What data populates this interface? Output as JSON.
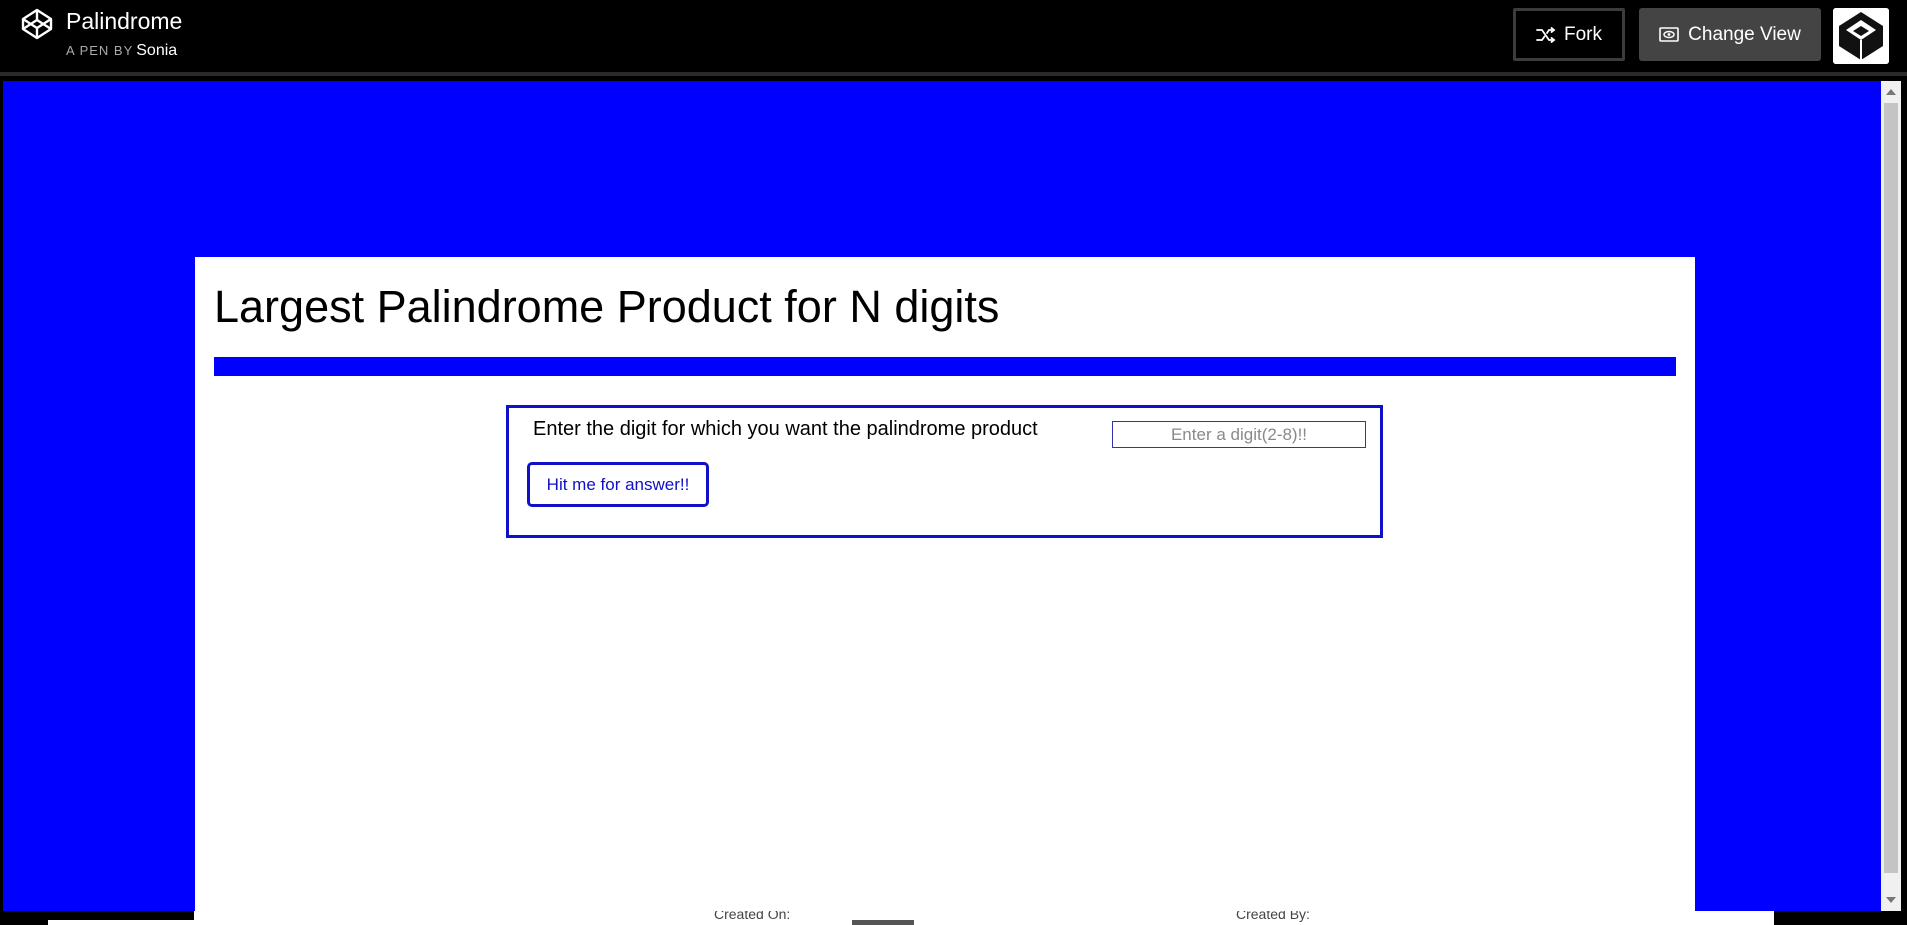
{
  "header": {
    "title": "Palindrome",
    "byline_prefix": "A PEN BY",
    "author": "Sonia",
    "fork_label": "Fork",
    "change_view_label": "Change View",
    "icons": {
      "logo": "codepen-logo-icon",
      "fork": "fork-icon",
      "change_view": "eye-icon",
      "avatar": "codepen-avatar-icon"
    }
  },
  "preview": {
    "background_color": "#0000fe",
    "heading": "Largest Palindrome Product for N digits",
    "form": {
      "label": "Enter the digit for which you want the palindrome product",
      "input_value": "",
      "input_placeholder": "Enter a digit(2-8)!!",
      "button_label": "Hit me for answer!!"
    },
    "accent_color": "#1010c8"
  },
  "footer": {
    "created_on_label": "Created On:",
    "created_by_label": "Created By:"
  }
}
